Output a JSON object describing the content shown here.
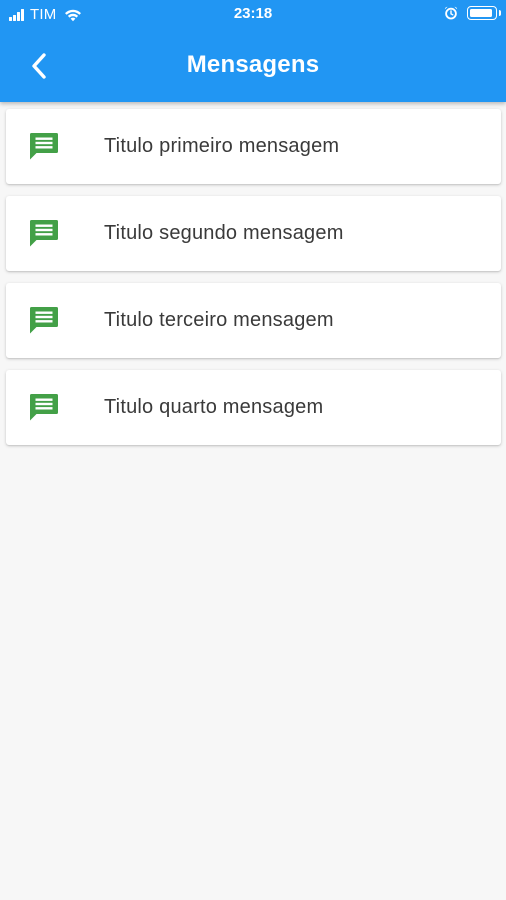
{
  "status_bar": {
    "carrier": "TIM",
    "time": "23:18",
    "battery_level": 0.9
  },
  "header": {
    "title": "Mensagens",
    "background_color": "#2196f3"
  },
  "messages": [
    {
      "title": "Titulo primeiro mensagem",
      "icon": "message-icon"
    },
    {
      "title": "Titulo segundo mensagem",
      "icon": "message-icon"
    },
    {
      "title": "Titulo terceiro mensagem",
      "icon": "message-icon"
    },
    {
      "title": "Titulo quarto mensagem",
      "icon": "message-icon"
    }
  ],
  "colors": {
    "accent": "#2196f3",
    "icon_green": "#43a047",
    "background": "#f7f7f7"
  }
}
